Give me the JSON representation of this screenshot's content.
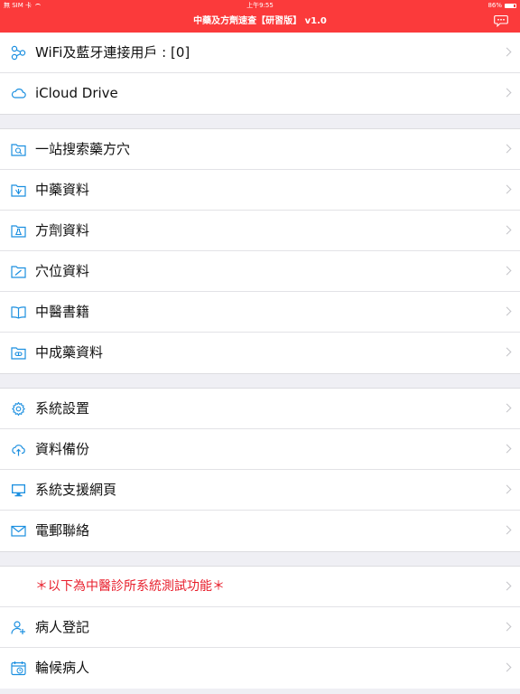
{
  "status_bar": {
    "carrier": "無 SIM 卡",
    "time": "上午9:55",
    "battery": "86%",
    "battery_level": 0.86
  },
  "nav": {
    "title": "中藥及方劑速查【研習版】 v1.0",
    "chat_icon": "chat-bubble-icon"
  },
  "colors": {
    "accent": "#fb3a3b",
    "icon_blue": "#1b8fe0",
    "highlight_red": "#e81f2c"
  },
  "sections": [
    {
      "rows": [
        {
          "label": "WiFi及藍牙連接用戶 : [0]",
          "icon": "connection-nodes-icon"
        },
        {
          "label": "iCloud Drive",
          "icon": "cloud-icon"
        }
      ]
    },
    {
      "rows": [
        {
          "label": "一站搜索藥方穴",
          "icon": "search-folder-icon"
        },
        {
          "label": "中藥資料",
          "icon": "herb-folder-icon"
        },
        {
          "label": "方劑資料",
          "icon": "formula-folder-icon"
        },
        {
          "label": "穴位資料",
          "icon": "acupoint-folder-icon"
        },
        {
          "label": "中醫書籍",
          "icon": "book-icon"
        },
        {
          "label": "中成藥資料",
          "icon": "medicine-folder-icon"
        }
      ]
    },
    {
      "rows": [
        {
          "label": "系統設置",
          "icon": "gear-icon"
        },
        {
          "label": "資料備份",
          "icon": "cloud-upload-icon"
        },
        {
          "label": "系統支援網頁",
          "icon": "monitor-icon"
        },
        {
          "label": "電郵聯絡",
          "icon": "mail-icon"
        }
      ]
    },
    {
      "rows": [
        {
          "label": "＊以下為中醫診所系統測試功能＊",
          "icon": ""
        },
        {
          "label": "病人登記",
          "icon": "add-user-icon"
        },
        {
          "label": "輪候病人",
          "icon": "calendar-clock-icon"
        }
      ]
    }
  ]
}
